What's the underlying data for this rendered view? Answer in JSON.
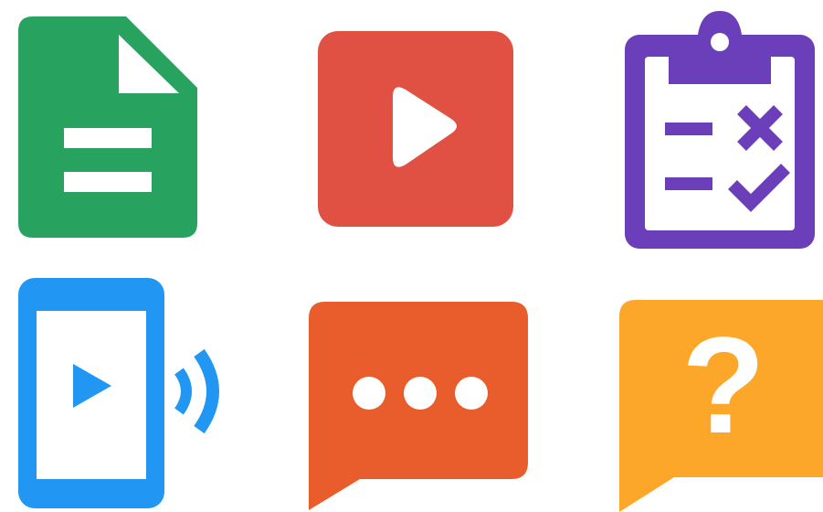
{
  "icons": [
    {
      "name": "document-icon",
      "color": "#27a35f"
    },
    {
      "name": "play-video-icon",
      "color": "#e05143"
    },
    {
      "name": "clipboard-checklist-icon",
      "color": "#6b3fb9"
    },
    {
      "name": "mobile-cast-video-icon",
      "color": "#2196f3"
    },
    {
      "name": "chat-bubble-ellipsis-icon",
      "color": "#e95c2c"
    },
    {
      "name": "chat-bubble-question-icon",
      "color": "#fda72a"
    }
  ],
  "question_icon": {
    "glyph": "?"
  }
}
